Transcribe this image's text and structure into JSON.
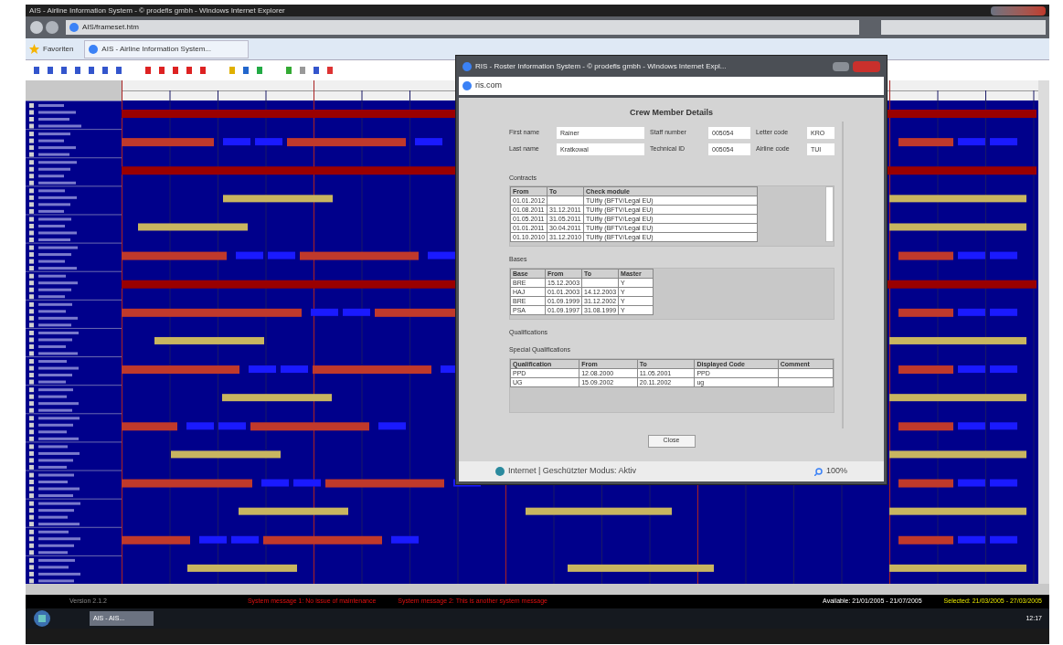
{
  "main_window": {
    "title": "AIS - Airline Information System - © prodefis gmbh - Windows Internet Explorer",
    "address": "AIS/frameset.htm",
    "favorites": "Favoriten",
    "tab": "AIS - Airline Information System..."
  },
  "dialog": {
    "title": "RIS - Roster Information System - © prodefis gmbh - Windows Internet Expl...",
    "address": "ris.com",
    "heading": "Crew Member Details",
    "fields": [
      {
        "label": "First name",
        "value": "Rainer"
      },
      {
        "label": "Staff number",
        "value": "005054"
      },
      {
        "label": "Letter code",
        "value": "KRO"
      },
      {
        "label": "Last name",
        "value": "Kratkowal"
      },
      {
        "label": "Technical ID",
        "value": "005054"
      },
      {
        "label": "Airline code",
        "value": "TUI"
      }
    ],
    "sections": [
      {
        "title": "Contracts",
        "columns": [
          "From",
          "To",
          "Check module"
        ],
        "rows": [
          [
            "01.01.2012",
            "",
            "TUIfly (BFTV/Legal EU)"
          ],
          [
            "01.08.2011",
            "31.12.2011",
            "TUIfly (BFTV/Legal EU)"
          ],
          [
            "01.05.2011",
            "31.05.2011",
            "TUIfly (BFTV/Legal EU)"
          ],
          [
            "01.01.2011",
            "30.04.2011",
            "TUIfly (BFTV/Legal EU)"
          ],
          [
            "01.10.2010",
            "31.12.2010",
            "TUIfly (BFTV/Legal EU)"
          ]
        ]
      },
      {
        "title": "Bases",
        "columns": [
          "Base",
          "From",
          "To",
          "Master"
        ],
        "rows": [
          [
            "BRE",
            "15.12.2003",
            "",
            "Y"
          ],
          [
            "HAJ",
            "01.01.2003",
            "14.12.2003",
            "Y"
          ],
          [
            "BRE",
            "01.09.1999",
            "31.12.2002",
            "Y"
          ],
          [
            "PSA",
            "01.09.1997",
            "31.08.1999",
            "Y"
          ]
        ]
      },
      {
        "title": "Qualifications"
      },
      {
        "title": "Special Qualifications",
        "columns": [
          "Qualification",
          "From",
          "To",
          "Displayed Code",
          "Comment"
        ],
        "rows": [
          [
            "PPD",
            "12.08.2000",
            "11.05.2001",
            "PPD",
            ""
          ],
          [
            "UG",
            "15.09.2002",
            "20.11.2002",
            "ug",
            ""
          ]
        ]
      }
    ],
    "close": "Close",
    "status": "Internet | Geschützter Modus: Aktiv",
    "zoom": "100%"
  },
  "status_bar": {
    "version": "Version 2.1.2",
    "messages": [
      "System message 1: No issue of maintenance",
      "System message 2: This is another system message"
    ],
    "available": "Available: 21/01/2005 - 21/07/2005",
    "selected": "Selected: 21/03/2005 - 27/03/2005"
  },
  "taskbar": {
    "app": "AIS - AIS...",
    "clock": "12:17"
  }
}
